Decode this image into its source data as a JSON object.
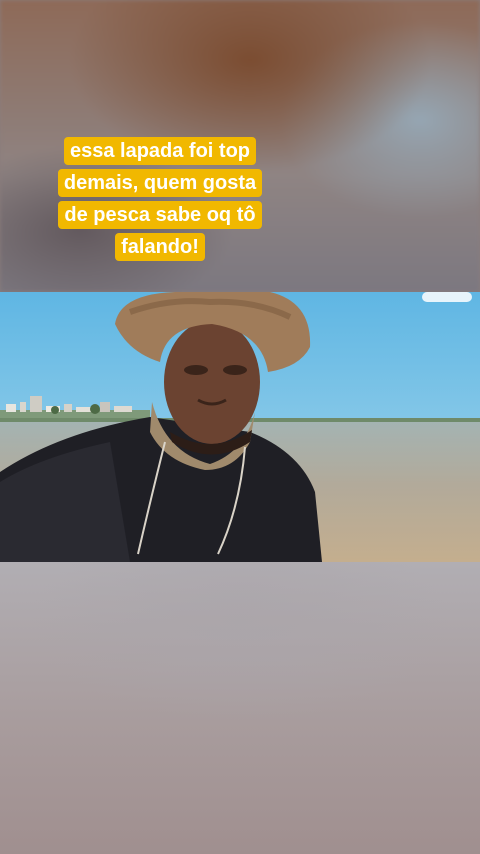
{
  "caption": {
    "lines": [
      "essa lapada foi top",
      "demais, quem gosta",
      "de pesca sabe oq tô",
      "falando!"
    ]
  },
  "video": {
    "colors": {
      "sky": "#5fb6e3",
      "water": "#b2aa9a",
      "shirt": "#1f1f25",
      "skin": "#6b4331",
      "hat": "#a07c5a",
      "caption_bg": "#f1b800"
    }
  }
}
